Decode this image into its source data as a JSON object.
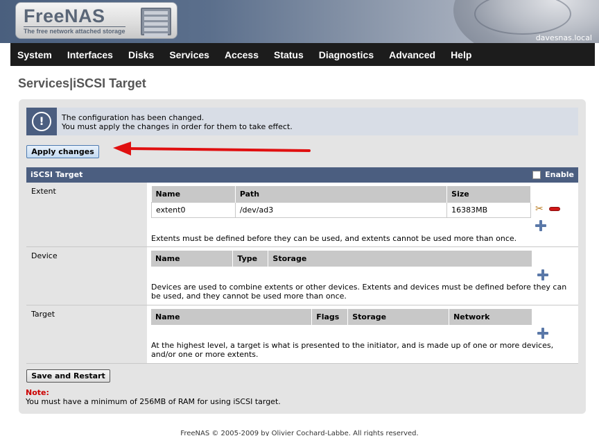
{
  "header": {
    "logo_name": "FreeNAS",
    "logo_tagline": "The free network attached storage",
    "hostname": "davesnas.local"
  },
  "nav": {
    "items": [
      "System",
      "Interfaces",
      "Disks",
      "Services",
      "Access",
      "Status",
      "Diagnostics",
      "Advanced",
      "Help"
    ]
  },
  "page": {
    "title": "Services|iSCSI Target"
  },
  "notice": {
    "line1": "The configuration has been changed.",
    "line2": "You must apply the changes in order for them to take effect."
  },
  "buttons": {
    "apply": "Apply changes",
    "save_restart": "Save and Restart"
  },
  "target_section": {
    "title": "iSCSI Target",
    "enable_label": "Enable",
    "enable_checked": false
  },
  "extent": {
    "label": "Extent",
    "columns": [
      "Name",
      "Path",
      "Size"
    ],
    "rows": [
      {
        "name": "extent0",
        "path": "/dev/ad3",
        "size": "16383MB"
      }
    ],
    "description": "Extents must be defined before they can be used, and extents cannot be used more than once."
  },
  "device": {
    "label": "Device",
    "columns": [
      "Name",
      "Type",
      "Storage"
    ],
    "description": "Devices are used to combine extents or other devices. Extents and devices must be defined before they can be used, and they cannot be used more than once."
  },
  "target": {
    "label": "Target",
    "columns": [
      "Name",
      "Flags",
      "Storage",
      "Network"
    ],
    "description": "At the highest level, a target is what is presented to the initiator, and is made up of one or more devices, and/or one or more extents."
  },
  "note": {
    "label": "Note:",
    "text": "You must have a minimum of 256MB of RAM for using iSCSI target."
  },
  "footer": {
    "text": "FreeNAS © 2005-2009 by Olivier Cochard-Labbe. All rights reserved."
  },
  "colors": {
    "header_bar": "#4b5e80",
    "nav_bg": "#1c1c1c",
    "note_red": "#cc0000",
    "arrow_red": "#e01010"
  },
  "icons": {
    "notice": "exclamation-circle-icon",
    "edit": "edit-tools-icon",
    "delete": "minus-icon",
    "add": "plus-icon",
    "server": "server-icon"
  }
}
